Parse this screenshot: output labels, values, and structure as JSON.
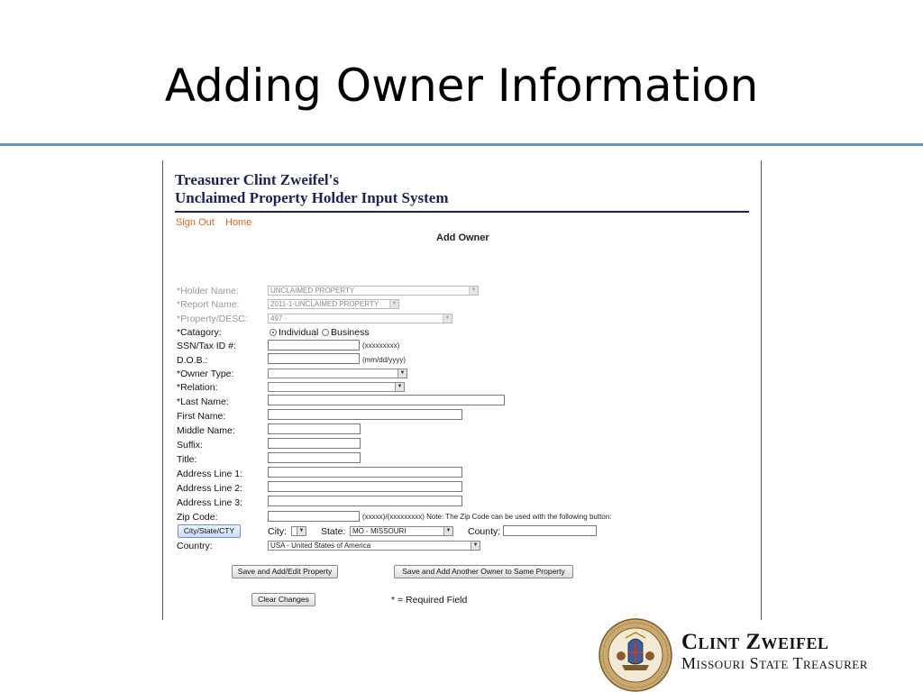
{
  "slide": {
    "title": "Adding Owner Information"
  },
  "app": {
    "title_line1": "Treasurer Clint Zweifel's",
    "title_line2": "Unclaimed Property Holder Input System",
    "nav": {
      "sign_out": "Sign Out",
      "home": "Home"
    },
    "page_heading": "Add Owner"
  },
  "form": {
    "holder_name": {
      "label": "*Holder Name:",
      "value": "UNCLAIMED PROPERTY"
    },
    "report_name": {
      "label": "*Report Name:",
      "value": "2011-1-UNCLAIMED PROPERTY"
    },
    "property_desc": {
      "label": "*Property/DESC:",
      "value": "497 -"
    },
    "category": {
      "label": "*Catagory:",
      "options": [
        "Individual",
        "Business"
      ],
      "selected": "Individual"
    },
    "ssn": {
      "label": "SSN/Tax ID #:",
      "value": "",
      "hint": "(xxxxxxxxx)"
    },
    "dob": {
      "label": "D.O.B.:",
      "value": "",
      "hint": "(mm/dd/yyyy)"
    },
    "owner_type": {
      "label": "*Owner Type:",
      "value": ""
    },
    "relation": {
      "label": "*Relation:",
      "value": ""
    },
    "last_name": {
      "label": "*Last Name:",
      "value": ""
    },
    "first_name": {
      "label": "First Name:",
      "value": ""
    },
    "middle_name": {
      "label": "Middle Name:",
      "value": ""
    },
    "suffix": {
      "label": "Suffix:",
      "value": ""
    },
    "title": {
      "label": "Title:",
      "value": ""
    },
    "address1": {
      "label": "Address Line 1:",
      "value": ""
    },
    "address2": {
      "label": "Address Line 2:",
      "value": ""
    },
    "address3": {
      "label": "Address Line 3:",
      "value": ""
    },
    "zip": {
      "label": "Zip Code:",
      "value": "",
      "hint": "(xxxxx)/(xxxxxxxxx)  Note: The Zip Code can be used with the following button:"
    },
    "city_button": "City/State/CTY",
    "city": {
      "label": "City:",
      "value": ""
    },
    "state": {
      "label": "State:",
      "value": "MO - MISSOURI"
    },
    "county": {
      "label": "County:",
      "value": ""
    },
    "country": {
      "label": "Country:",
      "value": "USA - United States of America"
    }
  },
  "actions": {
    "save_add_edit": "Save and Add/Edit Property",
    "save_add_another": "Save and Add Another Owner to Same Property",
    "clear": "Clear Changes",
    "required_note": "* = Required Field"
  },
  "branding": {
    "name": "Clint Zweifel",
    "subtitle": "Missouri State Treasurer",
    "seal_icon": "missouri-treasurer-seal-icon",
    "accent_color": "#6f8fc0",
    "header_color": "#1c2255",
    "link_color": "#d9661f"
  }
}
